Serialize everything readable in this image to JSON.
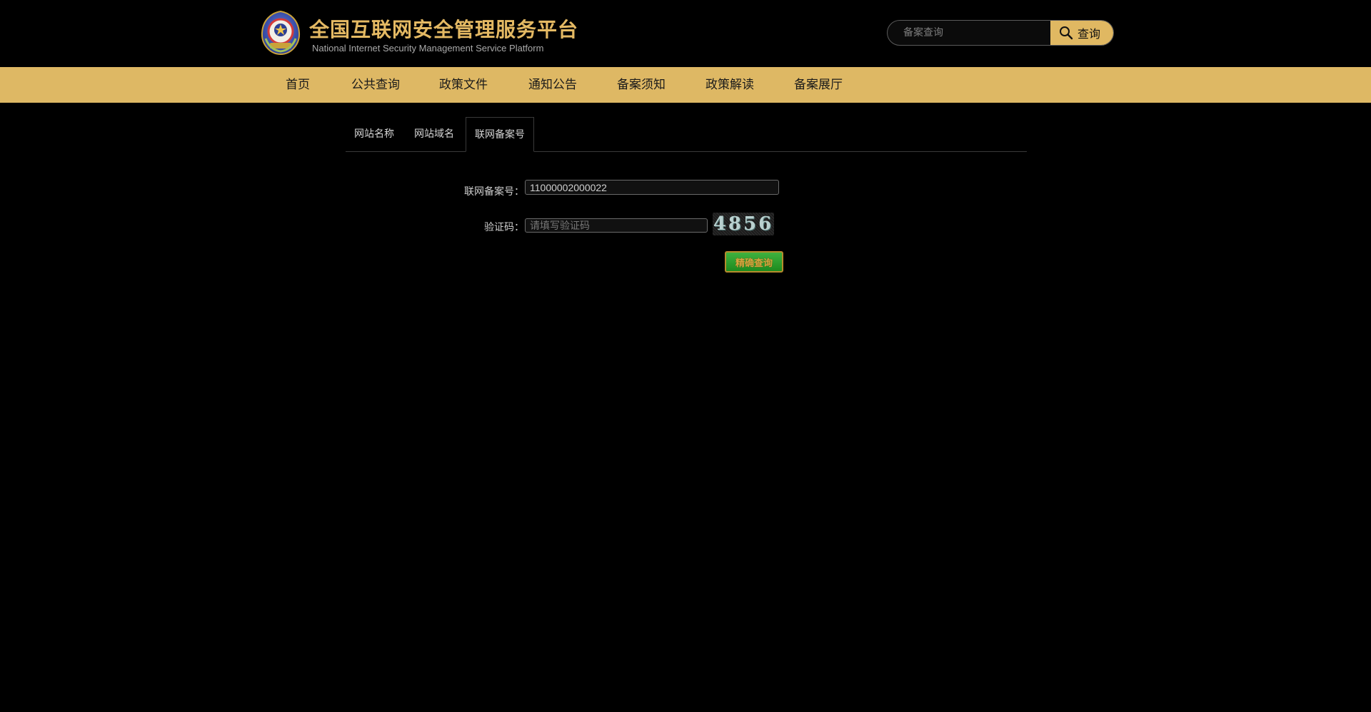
{
  "header": {
    "title": "全国互联网安全管理服务平台",
    "subtitle": "National Internet Security Management Service Platform",
    "emblem_icon": "police-emblem-icon",
    "search": {
      "placeholder": "备案查询",
      "button_label": "查询",
      "button_icon": "search-icon"
    }
  },
  "nav": {
    "items": [
      {
        "label": "首页"
      },
      {
        "label": "公共查询"
      },
      {
        "label": "政策文件"
      },
      {
        "label": "通知公告"
      },
      {
        "label": "备案须知"
      },
      {
        "label": "政策解读"
      },
      {
        "label": "备案展厅"
      }
    ]
  },
  "tabs": [
    {
      "label": "网站名称",
      "active": false
    },
    {
      "label": "网站域名",
      "active": false
    },
    {
      "label": "联网备案号",
      "active": true
    }
  ],
  "form": {
    "record_number": {
      "label": "联网备案号：",
      "value": "11000002000022"
    },
    "captcha": {
      "label": "验证码：",
      "placeholder": "请填写验证码",
      "image_text": "4856"
    },
    "submit_label": "精确查询"
  },
  "colors": {
    "accent": "#deb864",
    "title_gold": "#e4b963",
    "background": "#000000"
  }
}
